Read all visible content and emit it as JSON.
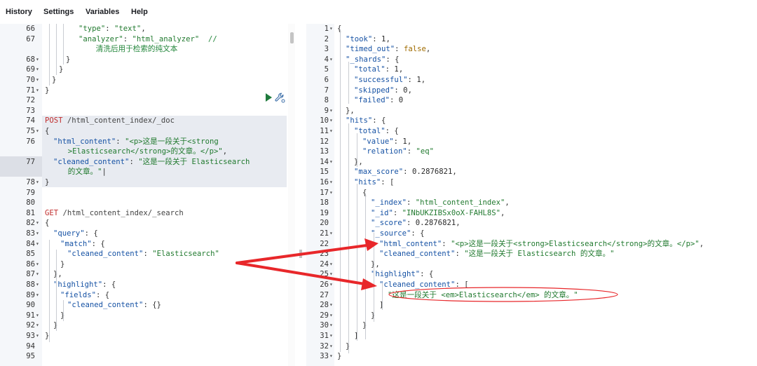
{
  "menu": [
    "History",
    "Settings",
    "Variables",
    "Help"
  ],
  "request": {
    "lines": [
      {
        "n": "66",
        "t": [
          {
            "c": "s",
            "v": "\"type\""
          },
          {
            "c": "p",
            "v": ": "
          },
          {
            "c": "s",
            "v": "\"text\""
          },
          {
            "c": "p",
            "v": ","
          }
        ]
      },
      {
        "n": "67",
        "t": [
          {
            "c": "s",
            "v": "\"analyzer\""
          },
          {
            "c": "p",
            "v": ": "
          },
          {
            "c": "s",
            "v": "\"html_analyzer\""
          },
          {
            "c": "c",
            "v": "  //"
          }
        ]
      },
      {
        "n": "",
        "t": [
          {
            "c": "c",
            "v": "  清洗后用于检索的纯文本"
          }
        ]
      },
      {
        "n": "68",
        "f": true,
        "t": [
          {
            "c": "p",
            "v": "}"
          }
        ]
      },
      {
        "n": "69",
        "f": true,
        "t": [
          {
            "c": "p",
            "v": "}"
          }
        ]
      },
      {
        "n": "70",
        "f": true,
        "t": [
          {
            "c": "p",
            "v": "}"
          }
        ]
      },
      {
        "n": "71",
        "f": true,
        "t": [
          {
            "c": "p",
            "v": "}"
          }
        ]
      },
      {
        "n": "72",
        "t": []
      },
      {
        "n": "73",
        "t": []
      },
      {
        "n": "74",
        "t": [
          {
            "c": "m",
            "v": "POST"
          },
          {
            "c": "u",
            "v": " /html_content_index/_doc"
          }
        ]
      },
      {
        "n": "75",
        "f": true,
        "t": [
          {
            "c": "p",
            "v": "{"
          }
        ]
      },
      {
        "n": "76",
        "t": [
          {
            "c": "k",
            "v": "\"html_content\""
          },
          {
            "c": "p",
            "v": ": "
          },
          {
            "c": "s",
            "v": "\"<p>这是一段关于<strong"
          }
        ]
      },
      {
        "n": "",
        "t": [
          {
            "c": "s",
            "v": "  >Elasticsearch</strong>的文章。</p>\""
          },
          {
            "c": "p",
            "v": ","
          }
        ]
      },
      {
        "n": "77",
        "t": [
          {
            "c": "k",
            "v": "\"cleaned_content\""
          },
          {
            "c": "p",
            "v": ": "
          },
          {
            "c": "s",
            "v": "\"这是一段关于 Elasticsearch"
          }
        ]
      },
      {
        "n": "",
        "t": [
          {
            "c": "s",
            "v": "  的文章。\""
          },
          {
            "c": "p",
            "v": "|"
          }
        ]
      },
      {
        "n": "78",
        "f": true,
        "t": [
          {
            "c": "p",
            "v": "}"
          }
        ]
      },
      {
        "n": "79",
        "t": []
      },
      {
        "n": "80",
        "t": []
      },
      {
        "n": "81",
        "t": [
          {
            "c": "m",
            "v": "GET"
          },
          {
            "c": "u",
            "v": " /html_content_index/_search"
          }
        ]
      },
      {
        "n": "82",
        "f": true,
        "t": [
          {
            "c": "p",
            "v": "{"
          }
        ]
      },
      {
        "n": "83",
        "f": true,
        "t": [
          {
            "c": "k",
            "v": "\"query\""
          },
          {
            "c": "p",
            "v": ": {"
          }
        ]
      },
      {
        "n": "84",
        "f": true,
        "t": [
          {
            "c": "k",
            "v": "\"match\""
          },
          {
            "c": "p",
            "v": ": {"
          }
        ]
      },
      {
        "n": "85",
        "t": [
          {
            "c": "k",
            "v": "\"cleaned_content\""
          },
          {
            "c": "p",
            "v": ": "
          },
          {
            "c": "s",
            "v": "\"Elasticsearch\""
          }
        ]
      },
      {
        "n": "86",
        "f": true,
        "t": [
          {
            "c": "p",
            "v": "}"
          }
        ]
      },
      {
        "n": "87",
        "f": true,
        "t": [
          {
            "c": "p",
            "v": "},"
          }
        ]
      },
      {
        "n": "88",
        "f": true,
        "t": [
          {
            "c": "k",
            "v": "\"highlight\""
          },
          {
            "c": "p",
            "v": ": {"
          }
        ]
      },
      {
        "n": "89",
        "f": true,
        "t": [
          {
            "c": "k",
            "v": "\"fields\""
          },
          {
            "c": "p",
            "v": ": {"
          }
        ]
      },
      {
        "n": "90",
        "t": [
          {
            "c": "k",
            "v": "\"cleaned_content\""
          },
          {
            "c": "p",
            "v": ": {}"
          }
        ]
      },
      {
        "n": "91",
        "f": true,
        "t": [
          {
            "c": "p",
            "v": "}"
          }
        ]
      },
      {
        "n": "92",
        "f": true,
        "t": [
          {
            "c": "p",
            "v": "}"
          }
        ]
      },
      {
        "n": "93",
        "f": true,
        "t": [
          {
            "c": "p",
            "v": "}"
          }
        ]
      },
      {
        "n": "94",
        "t": []
      },
      {
        "n": "95",
        "t": []
      }
    ]
  },
  "response": {
    "lines": [
      {
        "n": "1",
        "f": true,
        "t": [
          {
            "c": "p",
            "v": "{"
          }
        ]
      },
      {
        "n": "2",
        "t": [
          {
            "c": "k",
            "v": "\"took\""
          },
          {
            "c": "p",
            "v": ": "
          },
          {
            "c": "n",
            "v": "1"
          },
          {
            "c": "p",
            "v": ","
          }
        ]
      },
      {
        "n": "3",
        "t": [
          {
            "c": "k",
            "v": "\"timed_out\""
          },
          {
            "c": "p",
            "v": ": "
          },
          {
            "c": "b",
            "v": "false"
          },
          {
            "c": "p",
            "v": ","
          }
        ]
      },
      {
        "n": "4",
        "f": true,
        "t": [
          {
            "c": "k",
            "v": "\"_shards\""
          },
          {
            "c": "p",
            "v": ": {"
          }
        ]
      },
      {
        "n": "5",
        "t": [
          {
            "c": "k",
            "v": "\"total\""
          },
          {
            "c": "p",
            "v": ": "
          },
          {
            "c": "n",
            "v": "1"
          },
          {
            "c": "p",
            "v": ","
          }
        ]
      },
      {
        "n": "6",
        "t": [
          {
            "c": "k",
            "v": "\"successful\""
          },
          {
            "c": "p",
            "v": ": "
          },
          {
            "c": "n",
            "v": "1"
          },
          {
            "c": "p",
            "v": ","
          }
        ]
      },
      {
        "n": "7",
        "t": [
          {
            "c": "k",
            "v": "\"skipped\""
          },
          {
            "c": "p",
            "v": ": "
          },
          {
            "c": "n",
            "v": "0"
          },
          {
            "c": "p",
            "v": ","
          }
        ]
      },
      {
        "n": "8",
        "t": [
          {
            "c": "k",
            "v": "\"failed\""
          },
          {
            "c": "p",
            "v": ": "
          },
          {
            "c": "n",
            "v": "0"
          }
        ]
      },
      {
        "n": "9",
        "f": true,
        "t": [
          {
            "c": "p",
            "v": "},"
          }
        ]
      },
      {
        "n": "10",
        "f": true,
        "t": [
          {
            "c": "k",
            "v": "\"hits\""
          },
          {
            "c": "p",
            "v": ": {"
          }
        ]
      },
      {
        "n": "11",
        "f": true,
        "t": [
          {
            "c": "k",
            "v": "\"total\""
          },
          {
            "c": "p",
            "v": ": {"
          }
        ]
      },
      {
        "n": "12",
        "t": [
          {
            "c": "k",
            "v": "\"value\""
          },
          {
            "c": "p",
            "v": ": "
          },
          {
            "c": "n",
            "v": "1"
          },
          {
            "c": "p",
            "v": ","
          }
        ]
      },
      {
        "n": "13",
        "t": [
          {
            "c": "k",
            "v": "\"relation\""
          },
          {
            "c": "p",
            "v": ": "
          },
          {
            "c": "s",
            "v": "\"eq\""
          }
        ]
      },
      {
        "n": "14",
        "f": true,
        "t": [
          {
            "c": "p",
            "v": "},"
          }
        ]
      },
      {
        "n": "15",
        "t": [
          {
            "c": "k",
            "v": "\"max_score\""
          },
          {
            "c": "p",
            "v": ": "
          },
          {
            "c": "n",
            "v": "0.2876821"
          },
          {
            "c": "p",
            "v": ","
          }
        ]
      },
      {
        "n": "16",
        "f": true,
        "t": [
          {
            "c": "k",
            "v": "\"hits\""
          },
          {
            "c": "p",
            "v": ": ["
          }
        ]
      },
      {
        "n": "17",
        "f": true,
        "t": [
          {
            "c": "p",
            "v": "{"
          }
        ]
      },
      {
        "n": "18",
        "t": [
          {
            "c": "k",
            "v": "\"_index\""
          },
          {
            "c": "p",
            "v": ": "
          },
          {
            "c": "s",
            "v": "\"html_content_index\""
          },
          {
            "c": "p",
            "v": ","
          }
        ]
      },
      {
        "n": "19",
        "t": [
          {
            "c": "k",
            "v": "\"_id\""
          },
          {
            "c": "p",
            "v": ": "
          },
          {
            "c": "s",
            "v": "\"INbUKZIBSx0oX-FAHL8S\""
          },
          {
            "c": "p",
            "v": ","
          }
        ]
      },
      {
        "n": "20",
        "t": [
          {
            "c": "k",
            "v": "\"_score\""
          },
          {
            "c": "p",
            "v": ": "
          },
          {
            "c": "n",
            "v": "0.2876821"
          },
          {
            "c": "p",
            "v": ","
          }
        ]
      },
      {
        "n": "21",
        "f": true,
        "t": [
          {
            "c": "k",
            "v": "\"_source\""
          },
          {
            "c": "p",
            "v": ": {"
          }
        ]
      },
      {
        "n": "22",
        "t": [
          {
            "c": "k",
            "v": "\"html_content\""
          },
          {
            "c": "p",
            "v": ": "
          },
          {
            "c": "s",
            "v": "\"<p>这是一段关于<strong>Elasticsearch</strong>的文章。</p>\""
          },
          {
            "c": "p",
            "v": ","
          }
        ]
      },
      {
        "n": "23",
        "t": [
          {
            "c": "k",
            "v": "\"cleaned_content\""
          },
          {
            "c": "p",
            "v": ": "
          },
          {
            "c": "s",
            "v": "\"这是一段关于 Elasticsearch 的文章。\""
          }
        ]
      },
      {
        "n": "24",
        "f": true,
        "t": [
          {
            "c": "p",
            "v": "},"
          }
        ]
      },
      {
        "n": "25",
        "f": true,
        "t": [
          {
            "c": "k",
            "v": "\"highlight\""
          },
          {
            "c": "p",
            "v": ": {"
          }
        ]
      },
      {
        "n": "26",
        "f": true,
        "t": [
          {
            "c": "k",
            "v": "\"cleaned_content\""
          },
          {
            "c": "p",
            "v": ": ["
          }
        ]
      },
      {
        "n": "27",
        "t": [
          {
            "c": "s",
            "v": "\"这是一段关于 <em>Elasticsearch</em> 的文章。\""
          }
        ]
      },
      {
        "n": "28",
        "f": true,
        "t": [
          {
            "c": "p",
            "v": "]"
          }
        ]
      },
      {
        "n": "29",
        "f": true,
        "t": [
          {
            "c": "p",
            "v": "}"
          }
        ]
      },
      {
        "n": "30",
        "f": true,
        "t": [
          {
            "c": "p",
            "v": "}"
          }
        ]
      },
      {
        "n": "31",
        "f": true,
        "t": [
          {
            "c": "p",
            "v": "]"
          }
        ]
      },
      {
        "n": "32",
        "f": true,
        "t": [
          {
            "c": "p",
            "v": "}"
          }
        ]
      },
      {
        "n": "33",
        "f": true,
        "t": [
          {
            "c": "p",
            "v": "}"
          }
        ]
      }
    ]
  },
  "annotation_color": "#e8272a"
}
